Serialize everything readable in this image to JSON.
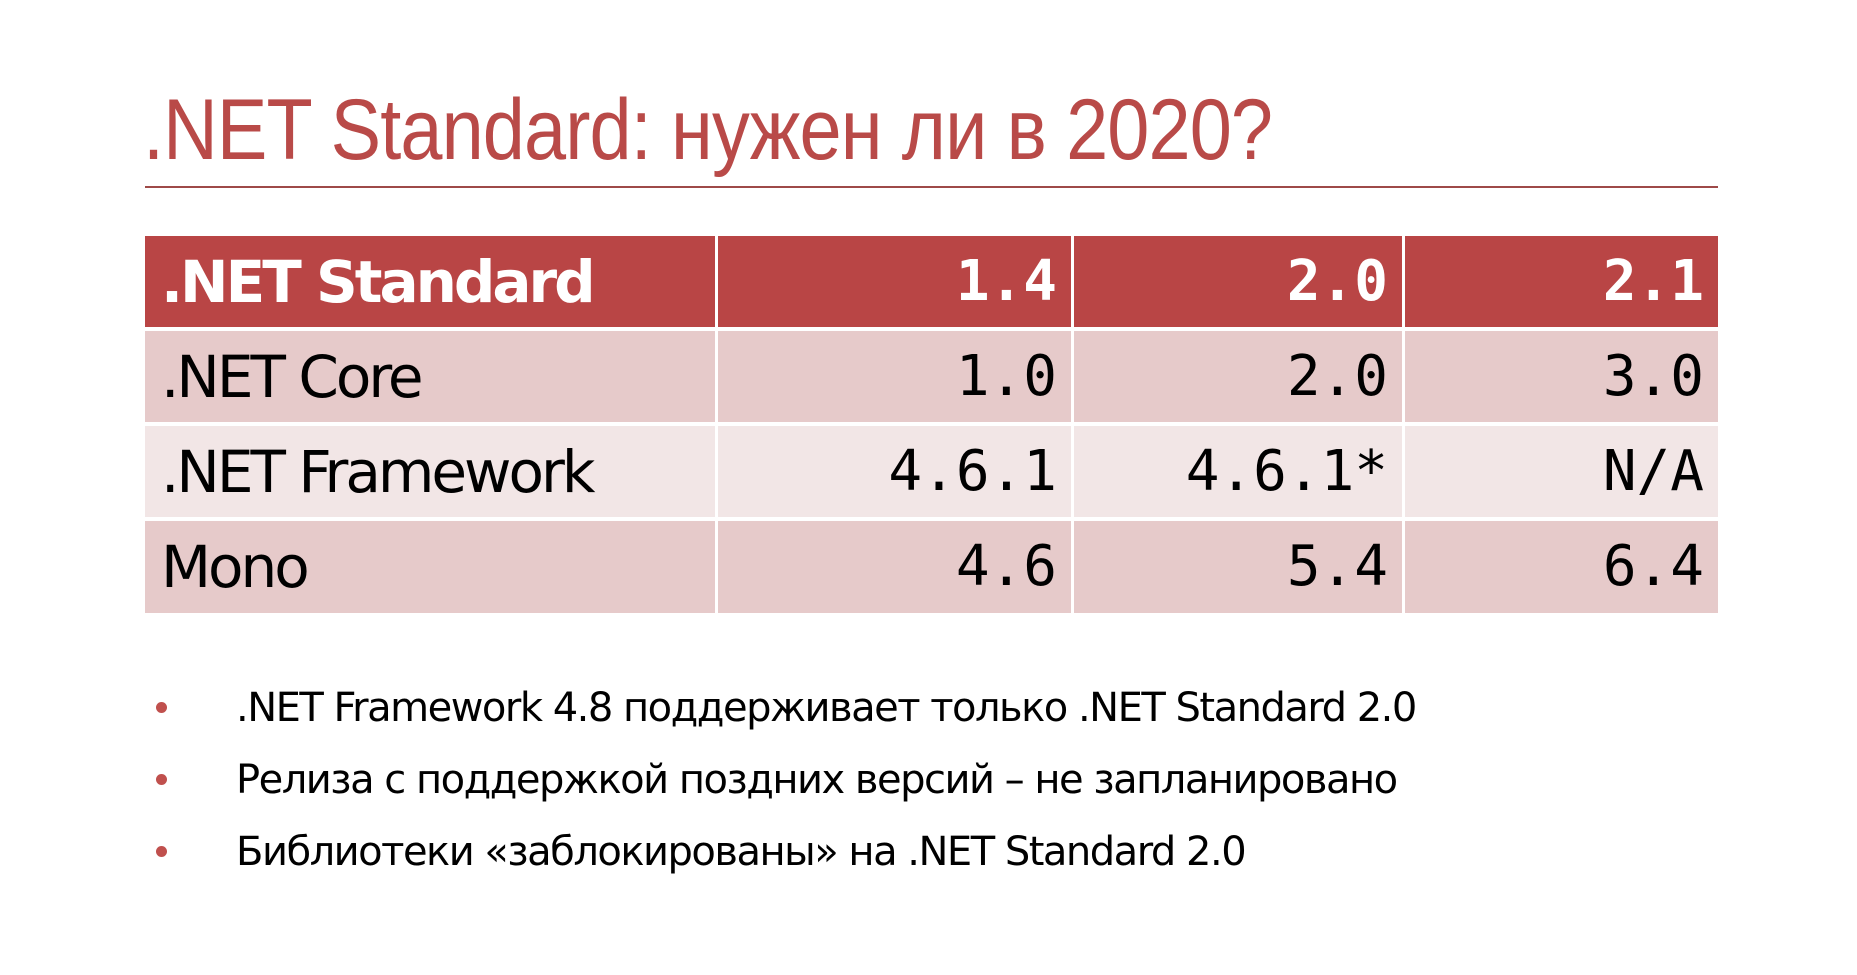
{
  "slide": {
    "title": ".NET Standard: нужен ли в 2020?",
    "accent_color": "#B94545"
  },
  "table": {
    "header": {
      "label": ".NET Standard",
      "versions": [
        "1.4",
        "2.0",
        "2.1"
      ]
    },
    "rows": [
      {
        "label": ".NET Core",
        "values": [
          "1.0",
          "2.0",
          "3.0"
        ]
      },
      {
        "label": ".NET Framework",
        "values": [
          "4.6.1",
          "4.6.1*",
          "N/A"
        ]
      },
      {
        "label": "Mono",
        "values": [
          "4.6",
          "5.4",
          "6.4"
        ]
      }
    ]
  },
  "bullets": [
    ".NET Framework 4.8 поддерживает только .NET Standard 2.0",
    "Релиза с поддержкой поздних версий – не запланировано",
    "Библиотеки «заблокированы» на .NET Standard 2.0"
  ]
}
